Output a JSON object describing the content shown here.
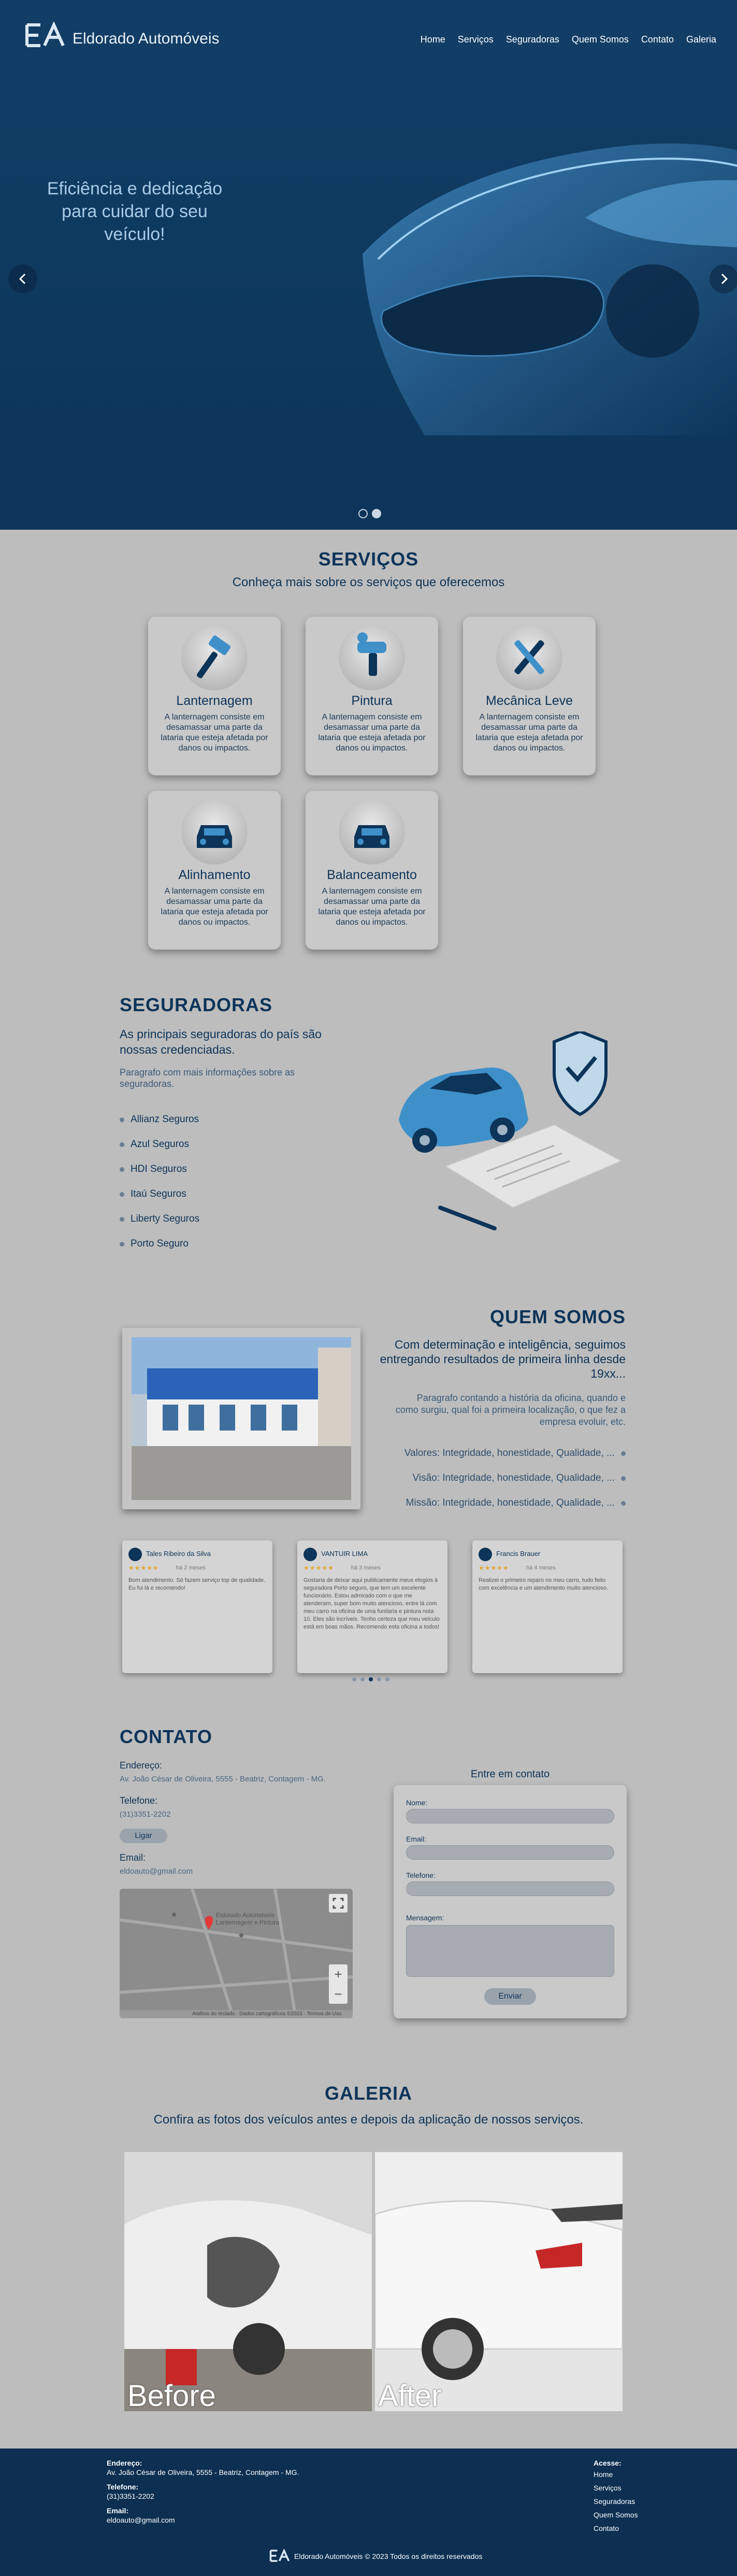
{
  "brand": {
    "name": "Eldorado Automóveis",
    "mark": "EA"
  },
  "nav": [
    "Home",
    "Serviços",
    "Seguradoras",
    "Quem Somos",
    "Contato",
    "Galeria"
  ],
  "hero": {
    "text": "Eficiência e dedicação para cuidar do seu veículo!",
    "slide_count": 2,
    "active_slide": 2
  },
  "services": {
    "title": "SERVIÇOS",
    "subtitle": "Conheça mais sobre os serviços que oferecemos",
    "items": [
      {
        "title": "Lanternagem",
        "desc": "A lanternagem consiste em desamassar uma parte da lataria que esteja afetada por danos ou impactos.",
        "icon": "hammer-icon"
      },
      {
        "title": "Pintura",
        "desc": "A lanternagem consiste em desamassar uma parte da lataria que esteja afetada por danos ou impactos.",
        "icon": "spray-gun-icon"
      },
      {
        "title": "Mecânica Leve",
        "desc": "A lanternagem consiste em desamassar uma parte da lataria que esteja afetada por danos ou impactos.",
        "icon": "wrench-screwdriver-icon"
      },
      {
        "title": "Alinhamento",
        "desc": "A lanternagem consiste em desamassar uma parte da lataria que esteja afetada por danos ou impactos.",
        "icon": "car-front-icon"
      },
      {
        "title": "Balanceamento",
        "desc": "A lanternagem consiste em desamassar uma parte da lataria que esteja afetada por danos ou impactos.",
        "icon": "car-front-icon"
      }
    ]
  },
  "insurers": {
    "title": "SEGURADORAS",
    "subtitle": "As principais seguradoras do país são nossas credenciadas.",
    "paragraph": "Paragrafo com mais informações sobre as seguradoras.",
    "list": [
      "Allianz Seguros",
      "Azul Seguros",
      "HDI Seguros",
      "Itaú Seguros",
      "Liberty Seguros",
      "Porto Seguro"
    ]
  },
  "about": {
    "title": "QUEM SOMOS",
    "subtitle": "Com determinação e inteligência, seguimos entregando resultados de primeira linha desde 19xx...",
    "paragraph": "Paragrafo contando a história da oficina, quando e como surgiu, qual foi a primeira localização, o que fez a empresa evoluir, etc.",
    "values": [
      "Valores: Integridade, honestidade, Qualidade, ...",
      "Visão: Integridade, honestidade, Qualidade, ...",
      "Missão: Integridade, honestidade, Qualidade, ..."
    ]
  },
  "reviews": {
    "items": [
      {
        "name": "Tales Ribeiro da Silva",
        "stars": "★★★★★",
        "time": "há 2 meses",
        "text": "Bom atendimento. Só fazem serviço top de qualidade. Eu fui lá e recomendo!"
      },
      {
        "name": "VANTUIR LIMA",
        "stars": "★★★★★",
        "time": "há 3 meses",
        "text": "Gostaria de deixar aqui publicamente meus elogios à seguradora Porto seguro, que tem um excelente funcionário. Estou admirado com o que me atenderam, super bom muito atencioso, entre lá com meu carro na oficina de uma funilaria e pintura nota 10. Eles são incríveis. Tenho certeza que meu veículo está em boas mãos. Recomendo esta oficina a todos!"
      },
      {
        "name": "Francis Brauer",
        "stars": "★★★★★",
        "time": "há 4 meses",
        "text": "Realizei o primeiro reparo no meu carro, tudo feito com excelência e um atendimento muito atencioso."
      }
    ],
    "page_count": 5,
    "active_page": 3
  },
  "contact": {
    "title": "CONTATO",
    "address_label": "Endereço:",
    "address": "Av. João César de Oliveira, 5555 - Beatriz, Contagem - MG.",
    "phone_label": "Telefone:",
    "phone": "(31)3351-2202",
    "call_button": "Ligar",
    "email_label": "Email:",
    "email": "eldoauto@gmail.com",
    "map": {
      "place": "Eldorado Automóveis Lanternagem e Pintura",
      "attribution": "Atalhos do teclado · Dados cartográficos ©2023 · Termos de Uso"
    },
    "form": {
      "title": "Entre em contato",
      "name_label": "Nome:",
      "email_label": "Email:",
      "phone_label": "Telefone:",
      "message_label": "Mensagem:",
      "submit": "Enviar"
    }
  },
  "gallery": {
    "title": "GALERIA",
    "subtitle": "Confira as fotos dos veículos antes e depois da aplicação de nossos serviços.",
    "before": "Before",
    "after": "After"
  },
  "footer": {
    "address_label": "Endereço:",
    "address": "Av. João César de Oliveira, 5555 - Beatriz, Contagem - MG.",
    "phone_label": "Telefone:",
    "phone": "(31)3351-2202",
    "email_label": "Email:",
    "email": "eldoauto@gmail.com",
    "links_label": "Acesse:",
    "links": [
      "Home",
      "Serviços",
      "Seguradoras",
      "Quem Somos",
      "Contato"
    ],
    "copyright": "Eldorado Automóveis © 2023 Todos os direitos reservados"
  },
  "colors": {
    "primary": "#0d3459",
    "background": "#bdbdbd",
    "card": "#c9c9c9",
    "footer": "#0c2f52",
    "accent_blue": "#4aa3d8"
  }
}
